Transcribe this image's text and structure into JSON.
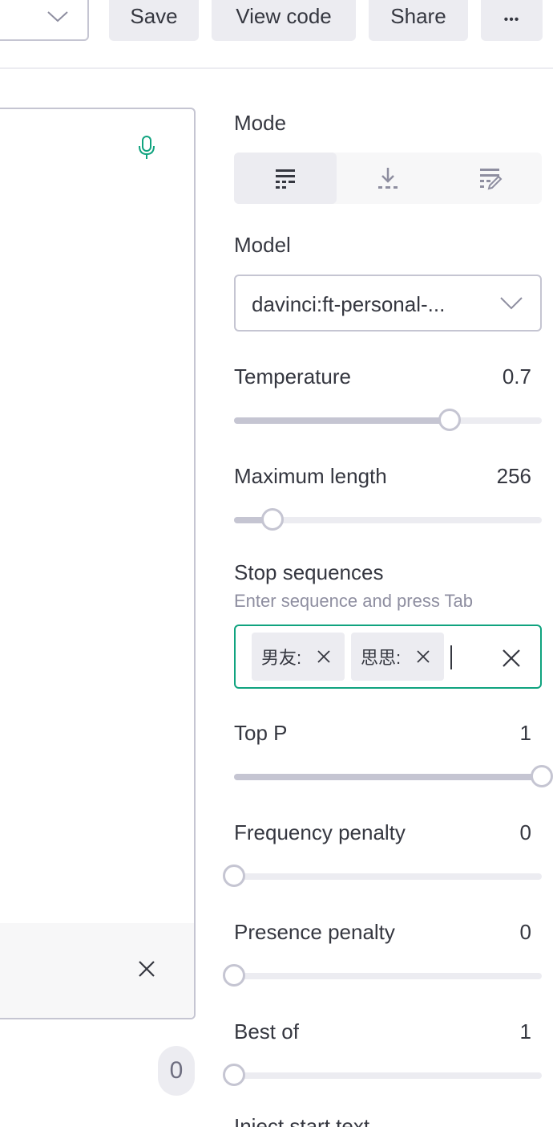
{
  "toolbar": {
    "save_label": "Save",
    "view_code_label": "View code",
    "share_label": "Share",
    "more_label": "•••"
  },
  "editor": {
    "token_count": "0"
  },
  "settings": {
    "mode": {
      "label": "Mode",
      "options": [
        "complete",
        "insert",
        "edit"
      ],
      "selected": "complete"
    },
    "model": {
      "label": "Model",
      "value": "davinci:ft-personal-..."
    },
    "temperature": {
      "label": "Temperature",
      "value": "0.7",
      "fraction": 0.7
    },
    "max_length": {
      "label": "Maximum length",
      "value": "256",
      "fraction": 0.125
    },
    "stop_sequences": {
      "label": "Stop sequences",
      "hint": "Enter sequence and press Tab",
      "chips": [
        "男友:",
        "思思:"
      ]
    },
    "top_p": {
      "label": "Top P",
      "value": "1",
      "fraction": 1.0
    },
    "frequency_penalty": {
      "label": "Frequency penalty",
      "value": "0",
      "fraction": 0.0
    },
    "presence_penalty": {
      "label": "Presence penalty",
      "value": "0",
      "fraction": 0.0
    },
    "best_of": {
      "label": "Best of",
      "value": "1",
      "fraction": 0.0
    },
    "inject_start_text": {
      "label": "Inject start text"
    }
  },
  "colors": {
    "accent": "#10a37f",
    "track": "#ececf1",
    "track_fill": "#c5c5d2"
  }
}
